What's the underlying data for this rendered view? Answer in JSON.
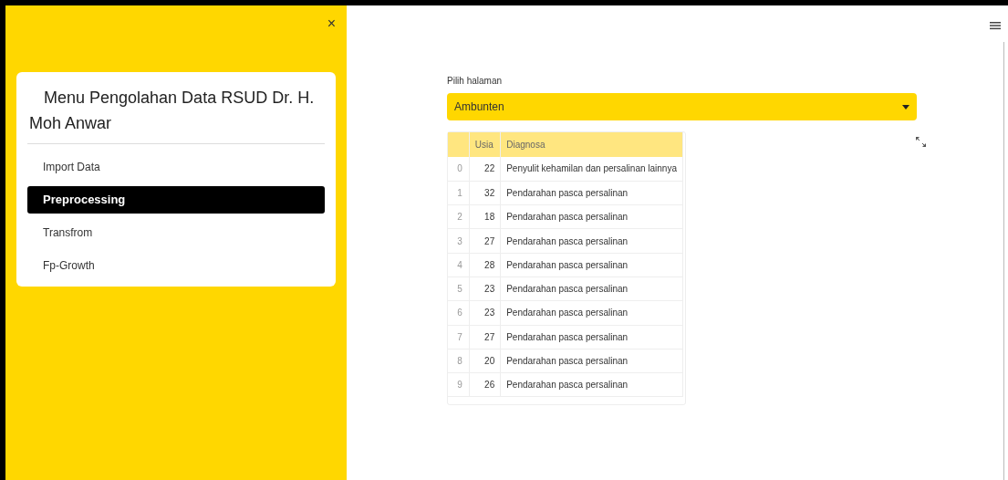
{
  "sidebar": {
    "close_icon": "×",
    "card_title": "Menu Pengolahan Data RSUD Dr. H. Moh Anwar",
    "items": [
      {
        "label": "Import Data",
        "selected": false
      },
      {
        "label": "Preprocessing",
        "selected": true
      },
      {
        "label": "Transfrom",
        "selected": false
      },
      {
        "label": "Fp-Growth",
        "selected": false
      }
    ]
  },
  "main": {
    "select_label": "Pilih halaman",
    "select_value": "Ambunten",
    "table": {
      "columns": [
        "",
        "Usia",
        "Diagnosa"
      ],
      "rows": [
        [
          "0",
          "22",
          "Penyulit kehamilan dan persalinan lainnya"
        ],
        [
          "1",
          "32",
          "Pendarahan pasca persalinan"
        ],
        [
          "2",
          "18",
          "Pendarahan pasca persalinan"
        ],
        [
          "3",
          "27",
          "Pendarahan pasca persalinan"
        ],
        [
          "4",
          "28",
          "Pendarahan pasca persalinan"
        ],
        [
          "5",
          "23",
          "Pendarahan pasca persalinan"
        ],
        [
          "6",
          "23",
          "Pendarahan pasca persalinan"
        ],
        [
          "7",
          "27",
          "Pendarahan pasca persalinan"
        ],
        [
          "8",
          "20",
          "Pendarahan pasca persalinan"
        ],
        [
          "9",
          "26",
          "Pendarahan pasca persalinan"
        ]
      ]
    }
  }
}
